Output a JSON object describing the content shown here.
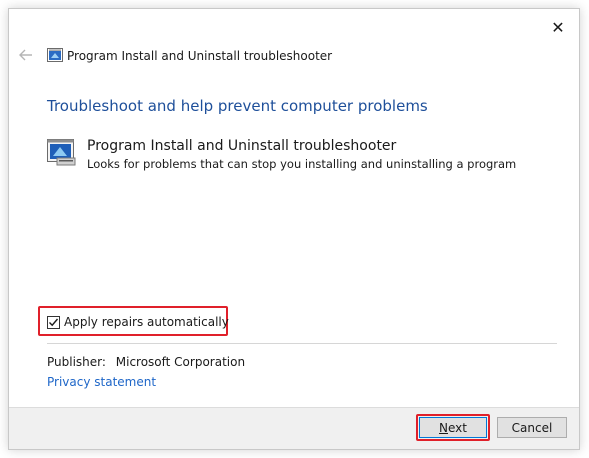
{
  "window": {
    "title": "Program Install and Uninstall troubleshooter",
    "close_glyph": "✕"
  },
  "main": {
    "heading": "Troubleshoot and help prevent computer problems",
    "troubleshooter": {
      "title": "Program Install and Uninstall troubleshooter",
      "description": "Looks for problems that can stop you installing and uninstalling a program",
      "icon": "troubleshooter-icon"
    },
    "apply_repairs": {
      "label": "Apply repairs automatically",
      "checked": true
    },
    "publisher": {
      "label": "Publisher:",
      "value": "Microsoft Corporation"
    },
    "privacy_link": "Privacy statement"
  },
  "footer": {
    "next_label": "Next",
    "cancel_label": "Cancel"
  },
  "colors": {
    "heading": "#1e4f9a",
    "link": "#1e66c8",
    "highlight": "#e0202a",
    "focus_border": "#0078d7"
  }
}
